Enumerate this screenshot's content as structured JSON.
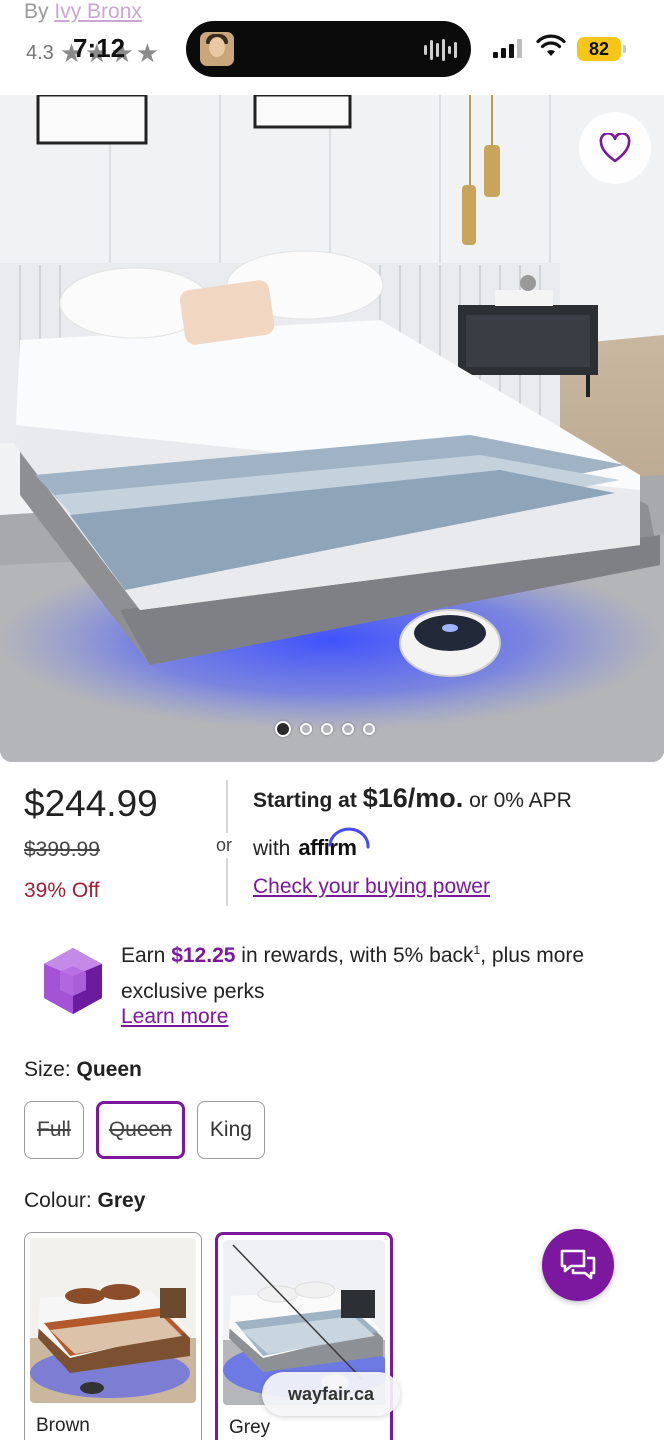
{
  "header": {
    "by_prefix": "By",
    "brand": "Ivy Bronx",
    "rating": "4.3",
    "stars": [
      "★",
      "★",
      "★",
      "★"
    ]
  },
  "status_bar": {
    "time": "7:12",
    "battery": "82"
  },
  "gallery": {
    "image_count": 5,
    "active_index": 0,
    "favorite_icon": "heart-outline-icon"
  },
  "pricing": {
    "price": "$244.99",
    "original_price": "$399.99",
    "discount": "39% Off",
    "or_label": "or",
    "financing_prefix": "Starting at",
    "financing_amount": "$16/mo.",
    "financing_suffix": "or 0% APR",
    "financing_with": "with",
    "financing_provider": "affirm",
    "financing_link": "Check your buying power"
  },
  "rewards": {
    "earn_prefix": "Earn",
    "amount": "$12.25",
    "earn_suffix": "in rewards, with 5% back",
    "footnote": "1",
    "tail": ", plus more exclusive perks",
    "link": "Learn more"
  },
  "size": {
    "label": "Size:",
    "selected": "Queen",
    "options": [
      {
        "label": "Full",
        "state": "unavailable"
      },
      {
        "label": "Queen",
        "state": "selected-unavailable"
      },
      {
        "label": "King",
        "state": "available"
      }
    ]
  },
  "colour": {
    "label": "Colour:",
    "selected": "Grey",
    "options": [
      {
        "label": "Brown",
        "state": "available"
      },
      {
        "label": "Grey",
        "state": "selected"
      }
    ]
  },
  "browser": {
    "url": "wayfair.ca"
  },
  "colors": {
    "accent": "#7b189f",
    "discount": "#a01e36"
  }
}
